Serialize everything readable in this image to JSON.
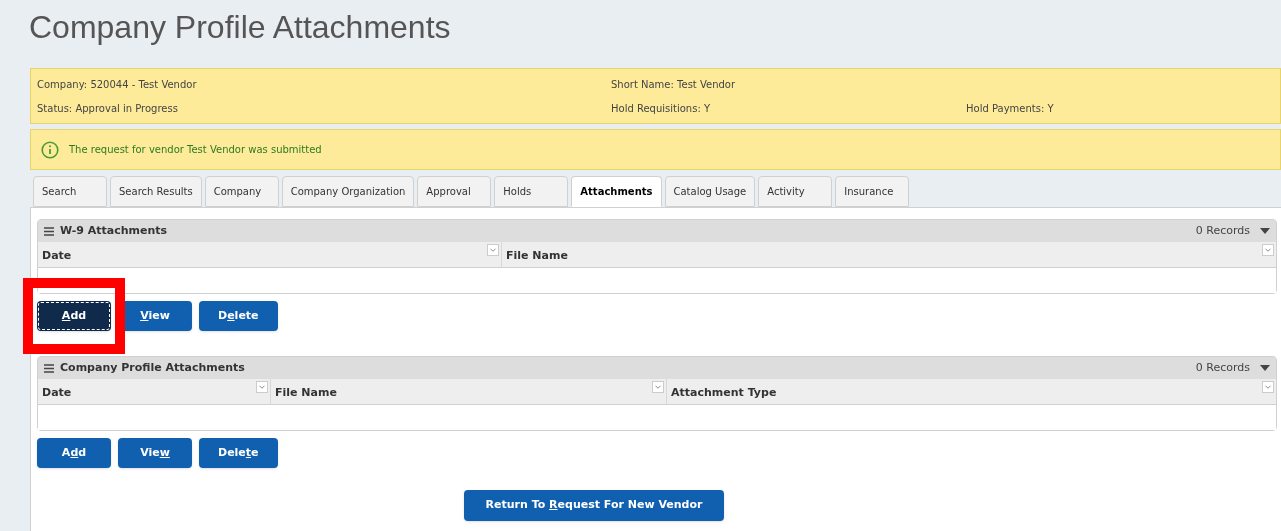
{
  "title": "Company Profile Attachments",
  "info": [
    {
      "left": "Company: 520044 - Test Vendor",
      "middle": "Short Name: Test Vendor"
    },
    {
      "left": "Status: Approval in Progress",
      "middle": "Hold Requisitions: Y",
      "right": "Hold Payments: Y"
    }
  ],
  "message": "The request for vendor Test Vendor was submitted",
  "tabs": [
    {
      "label": "Search",
      "selected": false
    },
    {
      "label": "Search Results",
      "selected": false
    },
    {
      "label": "Company",
      "selected": false
    },
    {
      "label": "Company Organization",
      "selected": false
    },
    {
      "label": "Approval",
      "selected": false
    },
    {
      "label": "Holds",
      "selected": false
    },
    {
      "label": "Attachments",
      "selected": true
    },
    {
      "label": "Catalog Usage",
      "selected": false
    },
    {
      "label": "Activity",
      "selected": false
    },
    {
      "label": "Insurance",
      "selected": false
    }
  ],
  "panels": [
    {
      "title": "W-9 Attachments",
      "records": "0 Records",
      "columns": [
        "Date",
        "File Name"
      ],
      "buttons": [
        {
          "label": {
            "key": "A",
            "after": "dd"
          },
          "focused": true,
          "highlighted": true
        },
        {
          "label": {
            "key": "V",
            "after": "iew"
          },
          "focused": false,
          "highlighted": false
        },
        {
          "label": {
            "before": "D",
            "key": "e",
            "after": "lete"
          },
          "focused": false,
          "highlighted": false
        }
      ]
    },
    {
      "title": "Company Profile Attachments",
      "records": "0 Records",
      "columns": [
        "Date",
        "File Name",
        "Attachment Type"
      ],
      "buttons": [
        {
          "label": {
            "before": "A",
            "key": "d",
            "after": "d"
          },
          "focused": false,
          "highlighted": false
        },
        {
          "label": {
            "before": "Vie",
            "key": "w"
          },
          "focused": false,
          "highlighted": false
        },
        {
          "label": {
            "before": "Dele",
            "key": "t",
            "after": "e"
          },
          "focused": false,
          "highlighted": false
        }
      ]
    }
  ],
  "return_button": {
    "label": {
      "before": "Return To ",
      "key": "R",
      "after": "equest For New Vendor"
    }
  }
}
